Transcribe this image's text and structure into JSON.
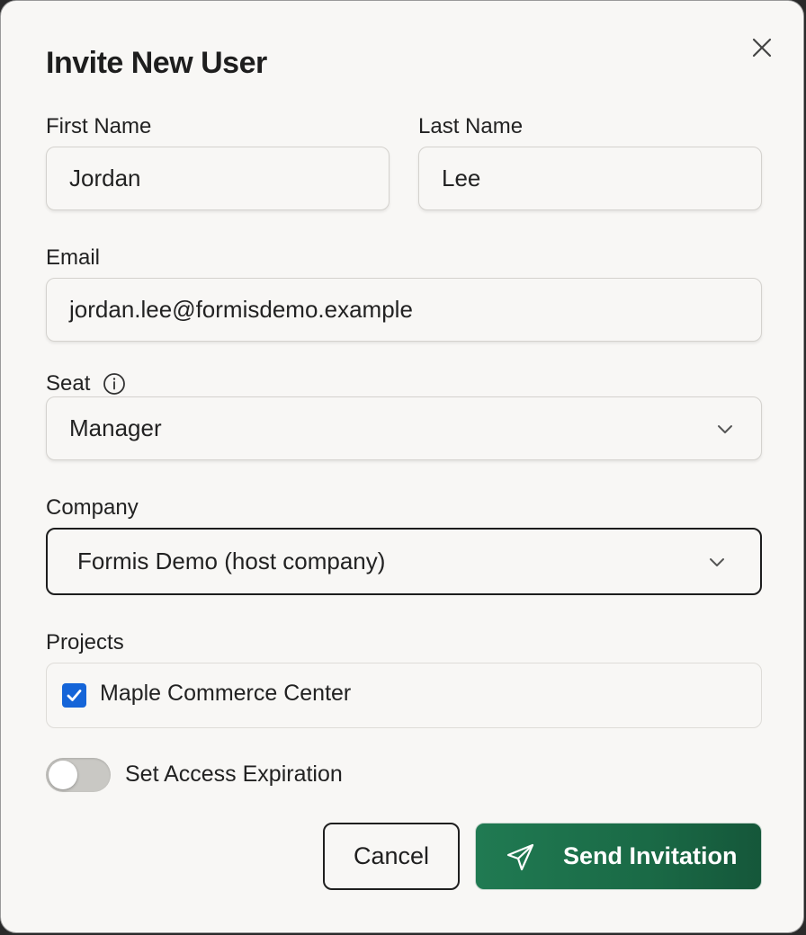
{
  "dialog": {
    "title": "Invite New User",
    "close_icon": "close-icon"
  },
  "form": {
    "first_name": {
      "label": "First Name",
      "value": "Jordan"
    },
    "last_name": {
      "label": "Last Name",
      "value": "Lee"
    },
    "email": {
      "label": "Email",
      "value": "jordan.lee@formisdemo.example"
    },
    "seat": {
      "label": "Seat",
      "value": "Manager",
      "info_icon": "info-icon"
    },
    "company": {
      "label": "Company",
      "value": "Formis Demo (host company)"
    },
    "projects": {
      "label": "Projects",
      "items": [
        {
          "label": "Maple Commerce Center",
          "checked": true
        }
      ]
    },
    "access_expiration": {
      "label": "Set Access Expiration",
      "enabled": false
    }
  },
  "actions": {
    "cancel_label": "Cancel",
    "send_label": "Send Invitation",
    "send_icon": "paper-plane-icon"
  },
  "colors": {
    "primary": "#1f7a50",
    "checkbox": "#1565d8",
    "background": "#f8f7f5"
  }
}
